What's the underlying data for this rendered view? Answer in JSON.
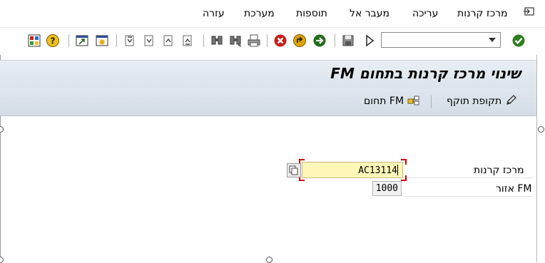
{
  "menu": {
    "items": [
      {
        "id": "funds_center",
        "label": "מרכז קרנות"
      },
      {
        "id": "edit",
        "label": "עריכה"
      },
      {
        "id": "goto",
        "label": "מעבר אל"
      },
      {
        "id": "extras",
        "label": "תוספות"
      },
      {
        "id": "system",
        "label": "מערכת"
      },
      {
        "id": "help",
        "label": "עזרה"
      }
    ]
  },
  "title": "שינוי מרכז קרנות בתחום FM",
  "app_toolbar": {
    "validity_period": "תקופת תוקף",
    "fm_area": "תחום FM"
  },
  "fields": {
    "funds_center": {
      "label": "מרכז קרנות",
      "value": "AC13114"
    },
    "fm_area": {
      "label": "אזור FM",
      "value": "1000"
    }
  },
  "colors": {
    "title_bar": "#dbe3eb",
    "input_highlight": "#fff7b8",
    "focus_border": "#d10000"
  }
}
